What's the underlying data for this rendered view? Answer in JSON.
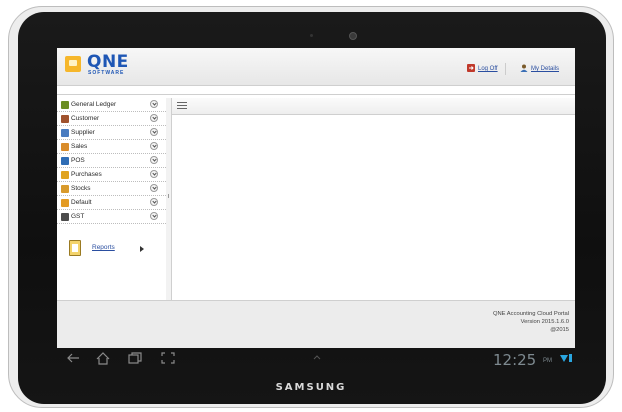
{
  "device": {
    "brand": "SAMSUNG",
    "status_bar": {
      "time": "12:25",
      "ampm": "PM"
    }
  },
  "app": {
    "logo": {
      "text": "QNE",
      "sub": "SOFTWARE"
    },
    "header_links": {
      "logoff": "Log Off",
      "details": "My Details"
    },
    "sidebar": {
      "items": [
        {
          "label": "General Ledger",
          "icon": "ledger-icon",
          "color": "#6b8e23"
        },
        {
          "label": "Customer",
          "icon": "customer-icon",
          "color": "#a0522d"
        },
        {
          "label": "Supplier",
          "icon": "supplier-icon",
          "color": "#4a7cc0"
        },
        {
          "label": "Sales",
          "icon": "sales-icon",
          "color": "#d98c2b"
        },
        {
          "label": "POS",
          "icon": "pos-icon",
          "color": "#2f6db5"
        },
        {
          "label": "Purchases",
          "icon": "purchases-icon",
          "color": "#e0a31f"
        },
        {
          "label": "Stocks",
          "icon": "stocks-icon",
          "color": "#d89a2c"
        },
        {
          "label": "Default",
          "icon": "default-icon",
          "color": "#e39b24"
        },
        {
          "label": "GST",
          "icon": "gst-icon",
          "color": "#4c4c4c"
        }
      ],
      "reports_label": "Reports"
    },
    "footer": {
      "line1": "QNE Accounting Cloud Portal",
      "line2": "Version 2015.1.6.0",
      "line3": "@2015"
    },
    "colors": {
      "link": "#2a4ea0",
      "logo": "#1f57b5",
      "logo_chip": "#f6b72b"
    }
  }
}
